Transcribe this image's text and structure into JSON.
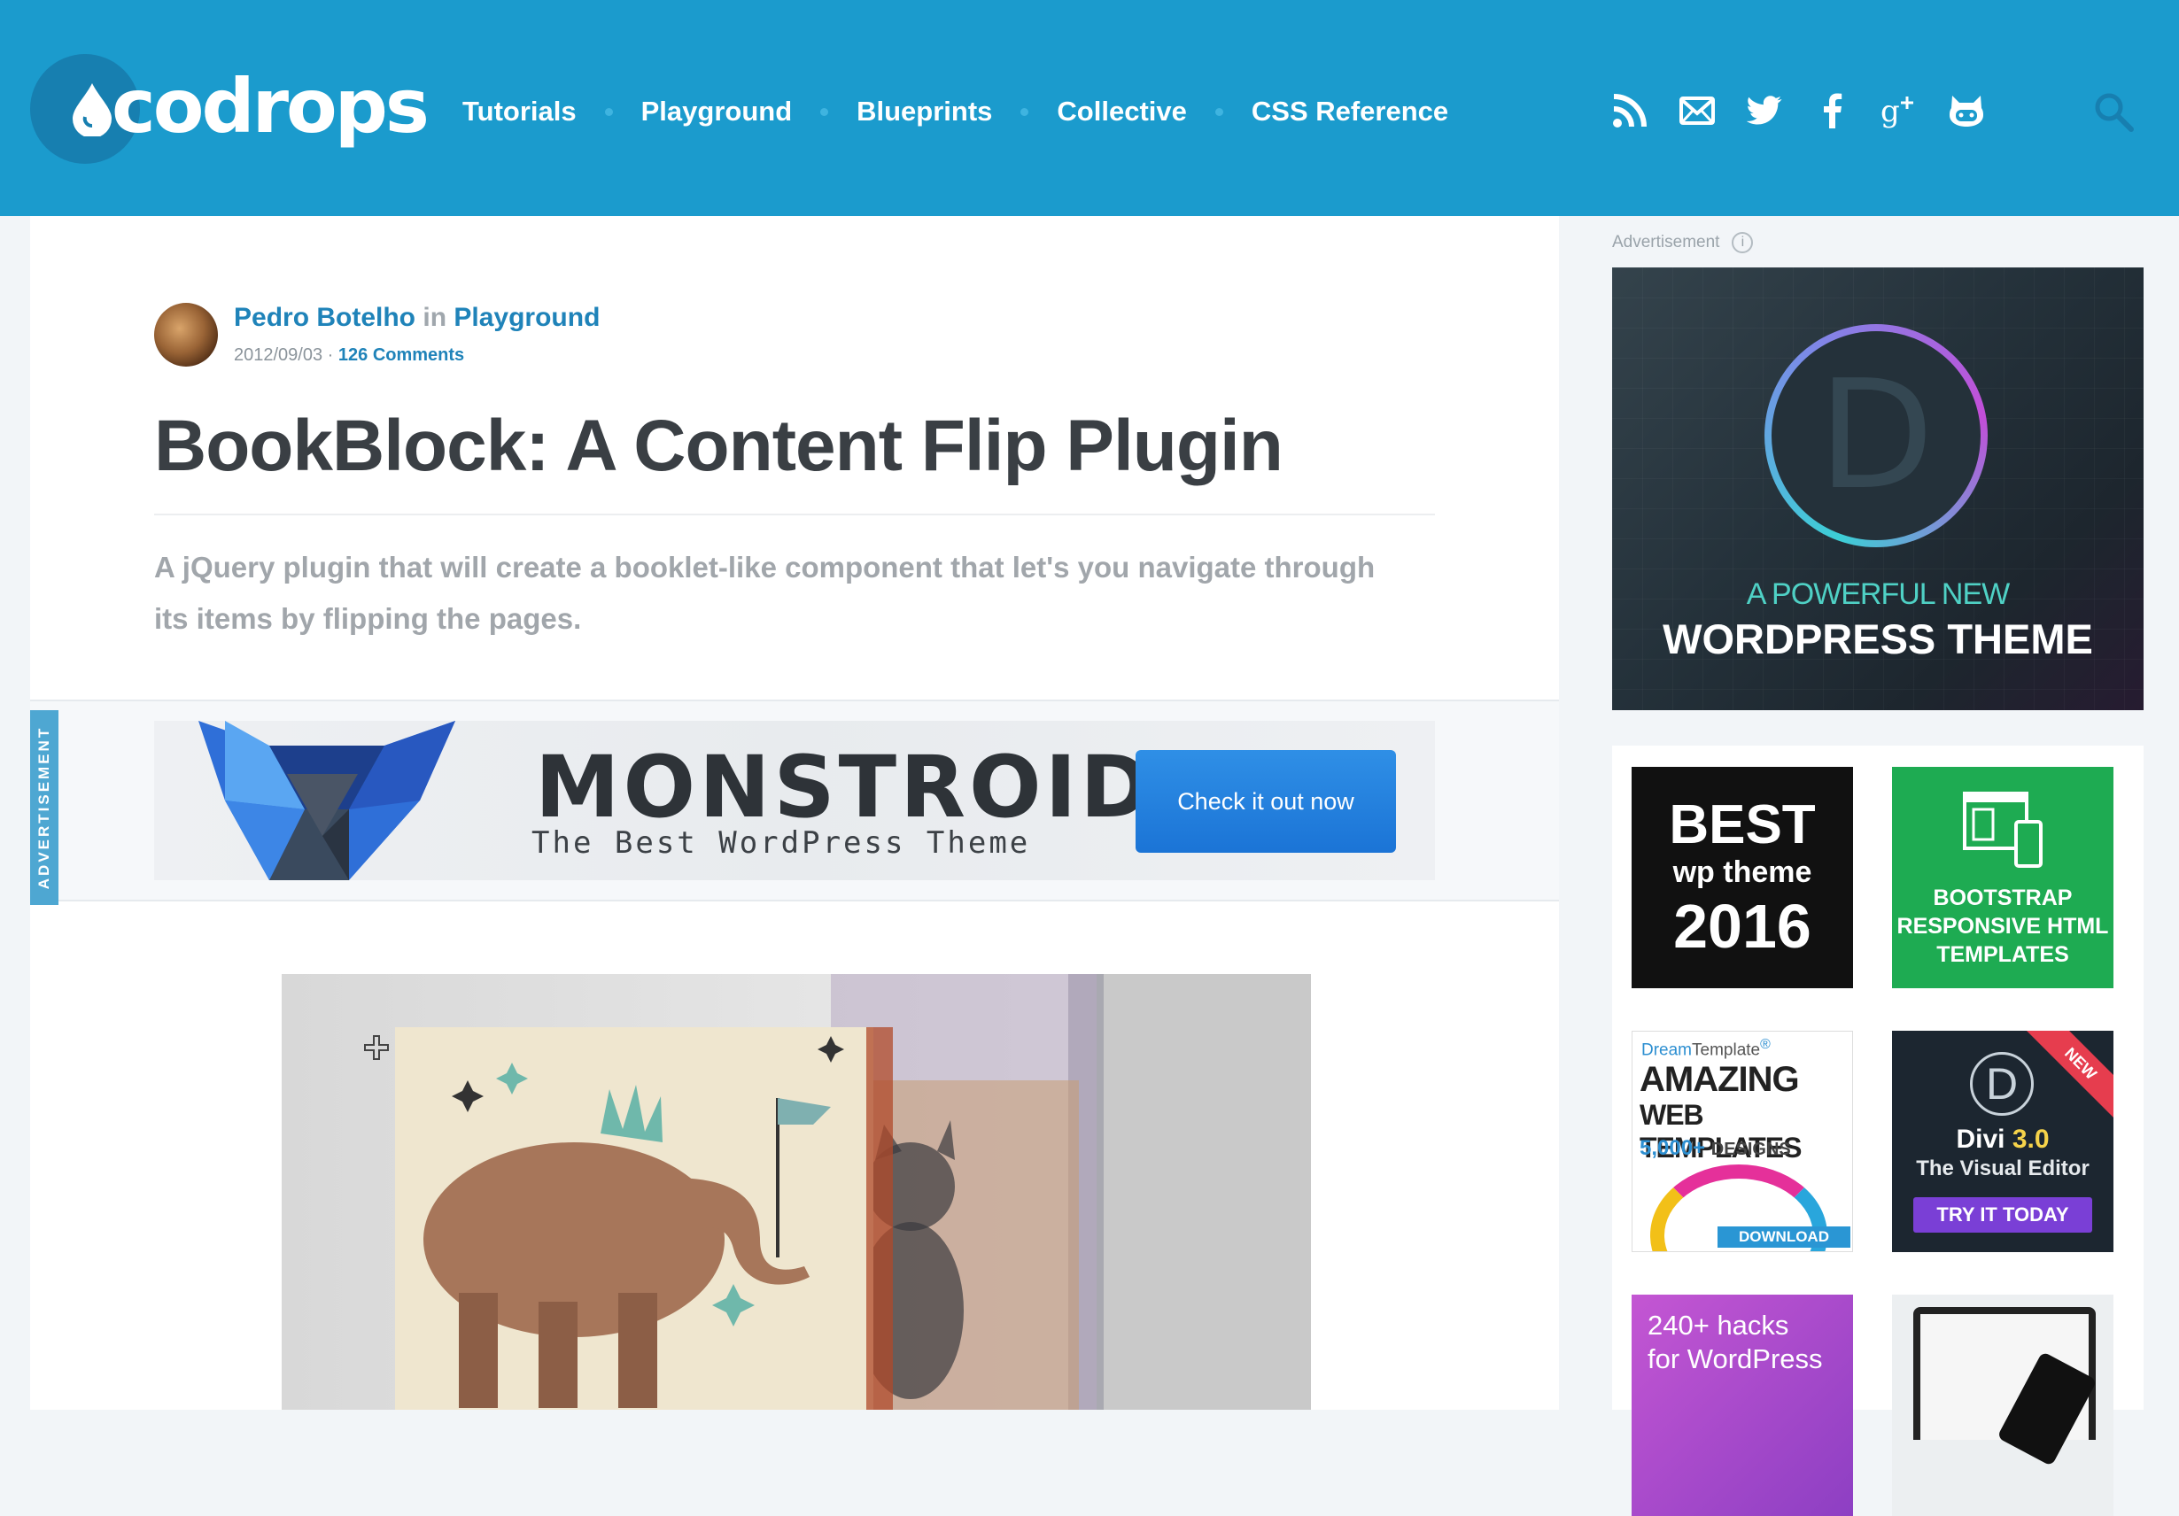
{
  "header": {
    "logo_text": "codrops",
    "nav": [
      "Tutorials",
      "Playground",
      "Blueprints",
      "Collective",
      "CSS Reference"
    ],
    "social_icons": [
      "rss-icon",
      "email-icon",
      "twitter-icon",
      "facebook-icon",
      "google-plus-icon",
      "github-icon"
    ],
    "search_icon": "search-icon",
    "colors": {
      "bar": "#1b9bcd",
      "text": "#ffffff"
    }
  },
  "article": {
    "author": "Pedro Botelho",
    "in_word": "in",
    "category": "Playground",
    "date": "2012/09/03",
    "separator": "·",
    "comments": "126 Comments",
    "title": "BookBlock: A Content Flip Plugin",
    "excerpt": "A jQuery plugin that will create a booklet-like component that let's you navigate through its items by flipping the pages."
  },
  "inline_ad": {
    "side_label": "ADVERTISEMENT",
    "title": "MONSTROID",
    "subtitle": "The Best WordPress Theme",
    "button": "Check it out now"
  },
  "sidebar": {
    "ad_label": "Advertisement",
    "info_icon": "i",
    "big_ad": {
      "letter": "D",
      "line1": "A POWERFUL NEW",
      "line2": "WORDPRESS THEME"
    },
    "ads": [
      {
        "l1": "BEST",
        "l2": "wp theme",
        "l3": "2016"
      },
      {
        "text": "BOOTSTRAP RESPONSIVE HTML TEMPLATES"
      },
      {
        "brand_a": "Dream",
        "brand_b": "Template",
        "brand_mark": "®",
        "l1": "AMAZING",
        "l2": "WEB TEMPLATES",
        "l3_num": "5,000+",
        "l3_word": "DESIGNS",
        "download": "DOWNLOAD"
      },
      {
        "ribbon": "NEW",
        "letter": "D",
        "title_a": "Divi",
        "title_b": "3.0",
        "subtitle": "The Visual Editor",
        "button": "TRY IT TODAY"
      },
      {
        "line1": "240+ hacks",
        "line2": "for WordPress"
      },
      {
        "kind": "laptop-phone-mockup"
      }
    ]
  }
}
